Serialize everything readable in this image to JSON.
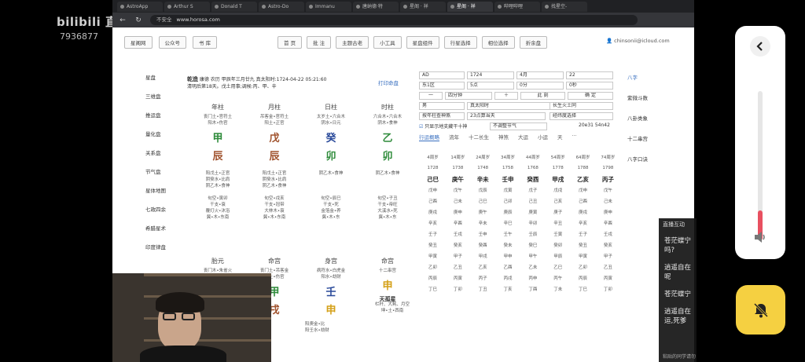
{
  "overlay": {
    "logo": "bilibili 直播",
    "room_number": "7936877"
  },
  "browser": {
    "tabs": [
      "AstroApp",
      "Arthur S",
      "Donald T",
      "Astro-Do",
      "Immanu",
      "唐纳德·特",
      "星阁 · 祥",
      "星阁 · 祥",
      "哔哩哔哩",
      "找星空-"
    ],
    "active_tab": 7,
    "url_warning": "不安全",
    "url": "www.horosa.com"
  },
  "page": {
    "top_links": [
      "星阁网",
      "公众号",
      "书 库"
    ],
    "nav": [
      "首 页",
      "批 注",
      "主题古老",
      "小工具",
      "星盘组件",
      "行星选择",
      "相位选择",
      "折余盘"
    ],
    "user_email": "chinsonii@icloud.com",
    "sidebar": [
      "星盘",
      "三维盘",
      "推运盘",
      "量化盘",
      "关系盘",
      "节气盘",
      "星体地图",
      "七政四余",
      "希腊星术",
      "印度律盘"
    ],
    "right_sidebar": [
      "八字",
      "紫微斗数",
      "八卦类象",
      "十二串宫",
      "八字口诀"
    ],
    "print_label": "打印命盘",
    "header": {
      "name": "乾造",
      "line1": "康德 农历 甲辰年三月廿九 真太阳时:1724-04-22 05:21:60",
      "line2": "清明后第18天。戊土用事;调候:丙、甲、辛"
    },
    "pillars": [
      {
        "title": "年柱",
        "l1": "丧门土•官符土",
        "l2": "阳木•伤官",
        "stem": "甲",
        "stem_color": "#2e8b3a",
        "branch": "辰",
        "branch_color": "#a0522d",
        "details": [
          "阳戊土•正官",
          "阴癸水•比肩",
          "阴乙木•食神",
          "",
          "旬空•寅卯",
          "干支•衰",
          "覆灯火•沐浴",
          "冀•木•东南"
        ]
      },
      {
        "title": "月柱",
        "l1": "吊客金•官符土",
        "l2": "阳土•正官",
        "stem": "戊",
        "stem_color": "#a0522d",
        "branch": "辰",
        "branch_color": "#a0522d",
        "details": [
          "阳戊土•正官",
          "阴癸水•比肩",
          "阴乙木•食神",
          "",
          "旬空•戌亥",
          "干支•冠带",
          "大林木•衰",
          "冀•木•东南"
        ]
      },
      {
        "title": "日柱",
        "l1": "太岁土•六合木",
        "l2": "阴水•日元",
        "stem": "癸",
        "stem_color": "#2a4a9a",
        "branch": "卯",
        "branch_color": "#2e8b3a",
        "details": [
          "阴乙木•食神",
          "",
          "",
          "",
          "旬空•辰巳",
          "干支•死",
          "金箔金•养",
          "冀•木•东"
        ]
      },
      {
        "title": "时柱",
        "l1": "六合木•六合木",
        "l2": "阴木•食神",
        "stem": "乙",
        "stem_color": "#2e8b3a",
        "branch": "卯",
        "branch_color": "#2e8b3a",
        "details": [
          "阴乙木•食神",
          "",
          "",
          "",
          "旬空•子丑",
          "干支•帝旺",
          "大溪水•死",
          "冀•木•东"
        ]
      }
    ],
    "lower_pillars": [
      {
        "title": "胎元",
        "l1": "丧门木•朱雀火",
        "l2": "",
        "stem": "",
        "branch": ""
      },
      {
        "title": "命宫",
        "l1": "丧门土•吊客金",
        "l2": "阳土•伤官",
        "stem": "甲",
        "stem_color": "#2e8b3a",
        "branch": "戌",
        "branch_color": "#a0522d"
      },
      {
        "title": "身宫",
        "l1": "病符水•白虎金",
        "l2": "阳水•劫财",
        "stem": "壬",
        "stem_color": "#2a4a9a",
        "branch": "申",
        "branch_color": "#d4a017"
      },
      {
        "title": "命宫",
        "l1": "十二串宫",
        "l2": "",
        "stem": "申",
        "stem_color": "#d4a017",
        "branch": "天孤星",
        "branch_color": "#333"
      }
    ],
    "lower_details": [
      "阳庚金•比",
      "阳壬水•劫财",
      "栏杆、大耗、月空",
      "坤•土•西南"
    ],
    "form": {
      "calendar": "AD",
      "year": "1724",
      "month": "4月",
      "day": "22",
      "zone": "东1区",
      "hour": "5点",
      "minute": "0分",
      "second": "0秒",
      "minus": "一",
      "time_label": "四分钟",
      "plus": "＋",
      "now": "此 刻",
      "confirm": "确 定",
      "gender": "男",
      "solar_time": "真太阳时",
      "element": "长生火土同",
      "method": "按年柱查神煞",
      "day_change": "23点算当天",
      "jingwei": "经纬度选择",
      "checkbox_label": "只显示地支藏干十神",
      "jieqi": "不调整节气",
      "coords": "20e31 54n42"
    },
    "luck_tabs": [
      "行运概略",
      "流年",
      "十二长生",
      "神煞",
      "大运",
      "小运",
      "天",
      "···"
    ],
    "luck_ages": [
      "4周岁",
      "14周岁",
      "24周岁",
      "34周岁",
      "44周岁",
      "54周岁",
      "64周岁",
      "74周岁"
    ],
    "luck_years": [
      "1728",
      "1738",
      "1748",
      "1758",
      "1768",
      "1778",
      "1788",
      "1798"
    ],
    "luck_pillars": [
      "己巳",
      "庚午",
      "辛未",
      "壬申",
      "癸酉",
      "甲戌",
      "乙亥",
      "丙子"
    ],
    "luck_rows": [
      [
        "戊申",
        "戊午",
        "戊辰",
        "戊寅",
        "戊子",
        "戊戌",
        "戊申",
        "戊午"
      ],
      [
        "己酉",
        "己未",
        "己巳",
        "己卯",
        "己丑",
        "己亥",
        "己酉",
        "己未"
      ],
      [
        "庚戌",
        "庚申",
        "庚午",
        "庚辰",
        "庚寅",
        "庚子",
        "庚戌",
        "庚申"
      ],
      [
        "辛亥",
        "辛酉",
        "辛未",
        "辛巳",
        "辛卯",
        "辛丑",
        "辛亥",
        "辛酉"
      ],
      [
        "壬子",
        "壬戌",
        "壬申",
        "壬午",
        "壬辰",
        "壬寅",
        "壬子",
        "壬戌"
      ],
      [
        "癸丑",
        "癸亥",
        "癸酉",
        "癸未",
        "癸巳",
        "癸卯",
        "癸丑",
        "癸亥"
      ],
      [
        "甲寅",
        "甲子",
        "甲戌",
        "甲申",
        "甲午",
        "甲辰",
        "甲寅",
        "甲子"
      ],
      [
        "乙卯",
        "乙丑",
        "乙亥",
        "乙酉",
        "乙未",
        "乙巳",
        "乙卯",
        "乙丑"
      ],
      [
        "丙辰",
        "丙寅",
        "丙子",
        "丙戌",
        "丙申",
        "丙午",
        "丙辰",
        "丙寅"
      ],
      [
        "丁巳",
        "丁卯",
        "丁丑",
        "丁亥",
        "丁酉",
        "丁未",
        "丁巳",
        "丁卯"
      ]
    ]
  },
  "chat": {
    "title": "直播互动",
    "messages": [
      "苍茫蝶宁吗?",
      "逍遥自在呢",
      "苍茫蝶宁",
      "逍遥自在运,死爹"
    ],
    "footer": "粘贴的同学请勿"
  },
  "volume": {
    "level": 0.2,
    "fill_color": "#e85060"
  },
  "colors": {
    "accent": "#3a70c0",
    "bell": "#f5d041"
  }
}
